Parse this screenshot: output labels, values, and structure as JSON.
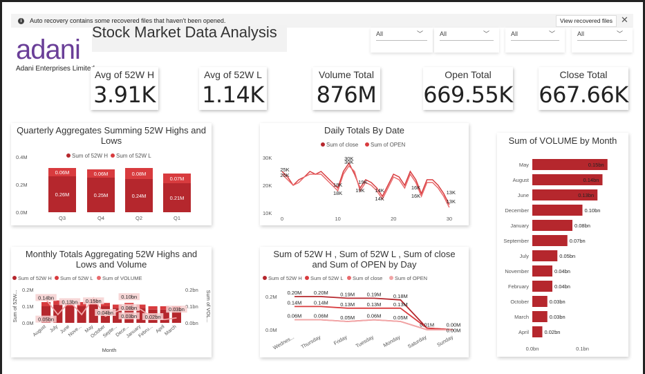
{
  "notification": {
    "message": "Auto recovery contains some recovered files that haven't been opened.",
    "button": "View recovered files",
    "close": "✕",
    "info": "i"
  },
  "title": "Stock Market Data Analysis",
  "logo": {
    "brand": "adani",
    "sub": "Adani Enterprises Limited"
  },
  "slicers": [
    {
      "value": "All"
    },
    {
      "value": "All"
    },
    {
      "value": "All"
    },
    {
      "value": "All"
    }
  ],
  "cards": [
    {
      "label": "Avg of 52W H",
      "value": "3.91K"
    },
    {
      "label": "Avg of 52W L",
      "value": "1.14K"
    },
    {
      "label": "Volume Total",
      "value": "876M"
    },
    {
      "label": "Open Total",
      "value": "669.55K"
    },
    {
      "label": "Close Total",
      "value": "667.66K"
    }
  ],
  "colors": {
    "dark_red": "#b5272d",
    "mid_red": "#d83b3e",
    "light_red": "#e86a6c",
    "pale_red": "#f1a5a6"
  },
  "chart_data": [
    {
      "type": "bar",
      "title": "Quarterly Aggregates Summing 52W Highs and Lows",
      "legend": [
        "Sum of 52W H",
        "Sum of 52W L"
      ],
      "categories": [
        "Q3",
        "Q4",
        "Q2",
        "Q1"
      ],
      "series": [
        {
          "name": "Sum of 52W H",
          "values": [
            0.26,
            0.25,
            0.24,
            0.21
          ],
          "labels": [
            "0.26M",
            "0.25M",
            "0.24M",
            "0.21M"
          ]
        },
        {
          "name": "Sum of 52W L",
          "values": [
            0.06,
            0.06,
            0.08,
            0.07
          ],
          "labels": [
            "0.06M",
            "0.06M",
            "0.08M",
            "0.07M"
          ]
        }
      ],
      "y_ticks": [
        "0.4M",
        "0.2M",
        "0.0M"
      ],
      "ylim": [
        0,
        0.4
      ]
    },
    {
      "type": "line",
      "title": "Daily Totals By Date",
      "legend": [
        "Sum of close",
        "Sum of OPEN"
      ],
      "x_ticks": [
        "0",
        "10",
        "20",
        "30"
      ],
      "y_ticks": [
        "30K",
        "20K",
        "10K"
      ],
      "ylim": [
        10,
        30
      ],
      "xlim": [
        0,
        32
      ],
      "series": [
        {
          "name": "Sum of close",
          "x": [
            0,
            1,
            2,
            3,
            4,
            5,
            6,
            7,
            8,
            9,
            10,
            11,
            12,
            13,
            14,
            15,
            16,
            17,
            18,
            19,
            20,
            21,
            22,
            23,
            24,
            25,
            26,
            27,
            28,
            29,
            30
          ],
          "y": [
            25,
            23,
            20,
            22,
            23,
            25,
            24,
            25,
            23,
            21,
            19,
            25,
            28,
            24,
            19,
            22,
            21,
            19,
            16,
            20,
            24,
            23,
            20,
            25,
            22,
            17,
            22,
            22,
            20,
            17,
            13
          ]
        },
        {
          "name": "Sum of OPEN",
          "x": [
            0,
            1,
            2,
            3,
            4,
            5,
            6,
            7,
            8,
            9,
            10,
            11,
            12,
            13,
            14,
            15,
            16,
            17,
            18,
            19,
            20,
            21,
            22,
            23,
            24,
            25,
            26,
            27,
            28,
            29,
            30
          ],
          "y": [
            24,
            22,
            20,
            21,
            23,
            24,
            24,
            24,
            22,
            20,
            18,
            24,
            27,
            25,
            18,
            21,
            20,
            18,
            15,
            19,
            23,
            22,
            19,
            24,
            21,
            16,
            21,
            21,
            19,
            16,
            12
          ]
        }
      ],
      "labels": [
        {
          "x": 0.5,
          "y": 25,
          "t": "25K"
        },
        {
          "x": 0.5,
          "y": 23,
          "t": "25K"
        },
        {
          "x": 12,
          "y": 29,
          "t": "30K"
        },
        {
          "x": 12,
          "y": 27.8,
          "t": "30K"
        },
        {
          "x": 10,
          "y": 19.5,
          "t": "18K"
        },
        {
          "x": 10,
          "y": 16.5,
          "t": "18K"
        },
        {
          "x": 14.5,
          "y": 20.5,
          "t": "19K"
        },
        {
          "x": 14,
          "y": 17.5,
          "t": "19K"
        },
        {
          "x": 17.5,
          "y": 17.5,
          "t": "14K"
        },
        {
          "x": 17.5,
          "y": 14.5,
          "t": "14K"
        },
        {
          "x": 24,
          "y": 18.5,
          "t": "16K"
        },
        {
          "x": 24,
          "y": 15.5,
          "t": "16K"
        },
        {
          "x": 30.3,
          "y": 16.8,
          "t": "13K"
        },
        {
          "x": 30.3,
          "y": 13.5,
          "t": "13K"
        }
      ]
    },
    {
      "type": "bar",
      "orientation": "horizontal",
      "title": "Sum of VOLUME by Month",
      "categories": [
        "May",
        "August",
        "June",
        "December",
        "January",
        "September",
        "July",
        "November",
        "February",
        "October",
        "March",
        "April"
      ],
      "values": [
        0.15,
        0.14,
        0.13,
        0.1,
        0.08,
        0.07,
        0.05,
        0.04,
        0.04,
        0.03,
        0.03,
        0.02
      ],
      "labels": [
        "0.15bn",
        "0.14bn",
        "0.13bn",
        "0.10bn",
        "0.08bn",
        "0.07bn",
        "0.05bn",
        "0.04bn",
        "0.04bn",
        "0.03bn",
        "0.03bn",
        "0.02bn"
      ],
      "x_ticks": [
        "0.0bn",
        "0.1bn"
      ],
      "xlim": [
        0,
        0.16
      ]
    },
    {
      "type": "bar",
      "title": "Monthly Totals Aggregating 52W Highs and Lows and Volume",
      "legend": [
        "Sum of 52W H",
        "Sum of 52W L",
        "Sum of VOLUME"
      ],
      "categories": [
        "August",
        "July",
        "June",
        "Nove...",
        "May",
        "October",
        "Septe...",
        "Dece...",
        "January",
        "Febru...",
        "April",
        "March"
      ],
      "series": [
        {
          "name": "Sum of 52W H",
          "values": [
            0.1,
            0.11,
            0.1,
            0.1,
            0.11,
            0.1,
            0.09,
            0.1,
            0.09,
            0.08,
            0.08,
            0.08
          ]
        },
        {
          "name": "Sum of 52W L",
          "values": [
            0.025,
            0.025,
            0.02,
            0.025,
            0.03,
            0.02,
            0.02,
            0.02,
            0.02,
            0.02,
            0.02,
            0.02
          ]
        },
        {
          "name": "Sum of VOLUME",
          "values": [
            0.14,
            0.05,
            0.13,
            0.05,
            0.15,
            0.04,
            0.07,
            0.1,
            0.08,
            0.03,
            0.02,
            0.03
          ]
        }
      ],
      "left_ticks": [
        "0.2M",
        "0.1M",
        "0.0M"
      ],
      "right_ticks": [
        "0.2bn",
        "0.1bn",
        "0.0bn"
      ],
      "ylabel": "Sum of 52W...",
      "y2label": "Sum of VOL...",
      "xlabel": "Month",
      "data_labels": [
        {
          "c": 0,
          "t": "0.14bn",
          "y": 0.14
        },
        {
          "c": 0,
          "t": "0.05bn",
          "y": 0.01
        },
        {
          "c": 2,
          "t": "0.13bn",
          "y": 0.115
        },
        {
          "c": 4,
          "t": "0.15bn",
          "y": 0.12
        },
        {
          "c": 5,
          "t": "0.04bn",
          "y": 0.05
        },
        {
          "c": 7,
          "t": "0.10bn",
          "y": 0.145
        },
        {
          "c": 7,
          "t": "0.08bn",
          "y": 0.08
        },
        {
          "c": 7,
          "t": "0.03bn",
          "y": 0.03
        },
        {
          "c": 9,
          "t": "0.02bn",
          "y": 0.025
        },
        {
          "c": 11,
          "t": "0.03bn",
          "y": 0.07
        }
      ]
    },
    {
      "type": "line",
      "title": "Sum of 52W H , Sum of 52W L , Sum of close and Sum of OPEN by Day",
      "legend": [
        "Sum of 52W H",
        "Sum of 52W L",
        "Sum of close",
        "Sum of OPEN"
      ],
      "categories": [
        "Wednes...",
        "Thursday",
        "Friday",
        "Tuesday",
        "Monday",
        "Saturday",
        "Sunday"
      ],
      "series": [
        {
          "name": "Sum of 52W H",
          "values": [
            0.2,
            0.2,
            0.19,
            0.19,
            0.18,
            0.01,
            0.0
          ]
        },
        {
          "name": "Sum of 52W L",
          "values": [
            0.14,
            0.14,
            0.13,
            0.13,
            0.13,
            0.01,
            0.0
          ]
        },
        {
          "name": "Sum of close",
          "values": [
            0.06,
            0.06,
            0.05,
            0.06,
            0.05,
            0.0,
            0.0
          ]
        },
        {
          "name": "Sum of OPEN",
          "values": [
            0.06,
            0.06,
            0.05,
            0.06,
            0.05,
            0.0,
            0.0
          ]
        }
      ],
      "point_labels": [
        [
          "0.20M",
          "0.20M",
          "0.19M",
          "0.19M",
          "0.18M",
          "0.01M",
          "0.00M"
        ],
        [
          "0.14M",
          "0.14M",
          "0.13M",
          "0.13M",
          "0.13M",
          "",
          ""
        ],
        [
          "0.06M",
          "0.06M",
          "0.05M",
          "0.06M",
          "0.05M",
          "",
          "0.00M"
        ]
      ],
      "y_ticks": [
        "0.2M",
        "0.0M"
      ],
      "ylim": [
        0,
        0.25
      ]
    }
  ]
}
